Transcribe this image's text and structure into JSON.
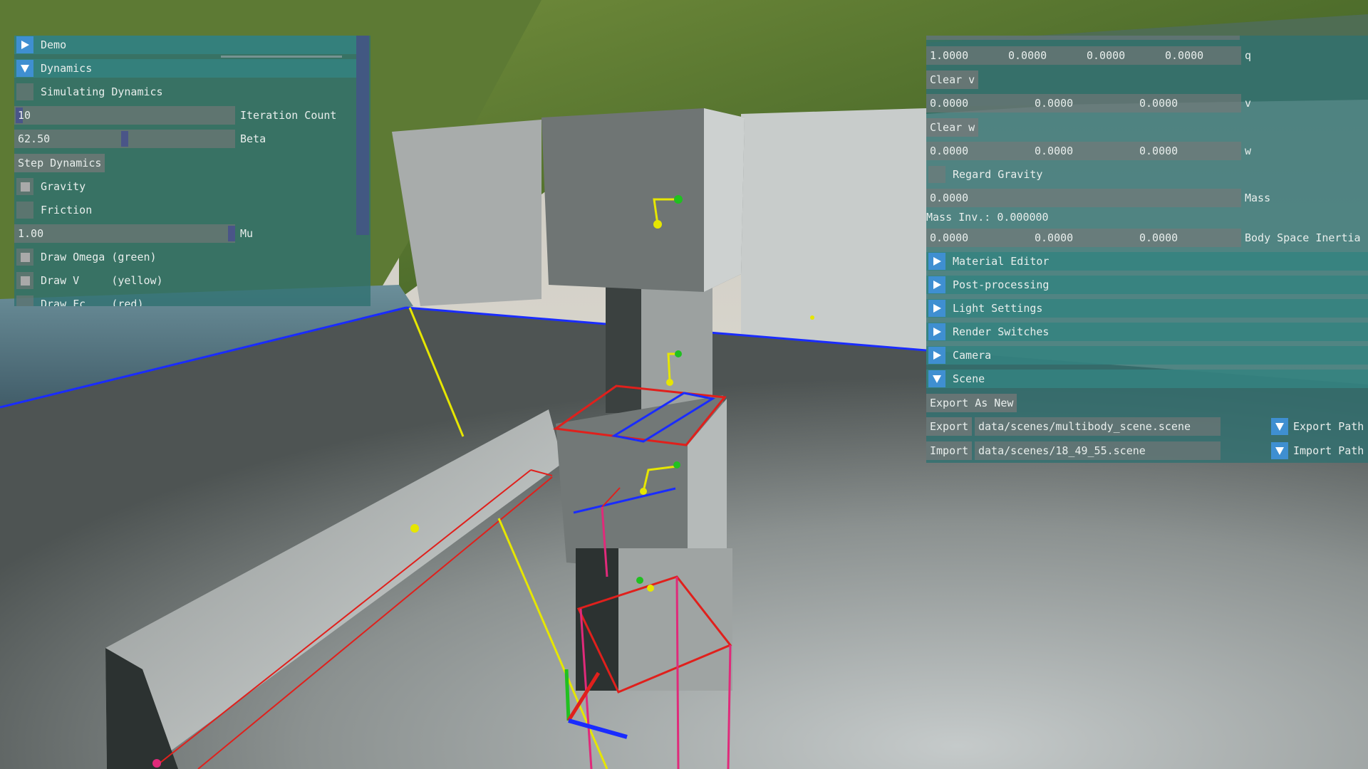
{
  "left_panel": {
    "demo_header": "Demo",
    "dynamics_header": "Dynamics",
    "simulating_dynamics": "Simulating Dynamics",
    "iteration_count": {
      "value": "10",
      "label": "Iteration Count"
    },
    "beta": {
      "value": "62.50",
      "label": "Beta"
    },
    "step_dynamics": "Step Dynamics",
    "gravity": "Gravity",
    "friction": "Friction",
    "mu": {
      "value": "1.00",
      "label": "Mu"
    },
    "draw_omega": "Draw Omega (green)",
    "draw_v": "Draw V     (yellow)",
    "draw_fc": "Draw Fc    (red)"
  },
  "right_panel": {
    "q": {
      "values": [
        "1.0000",
        "0.0000",
        "0.0000",
        "0.0000"
      ],
      "label": "q"
    },
    "clear_v": "Clear v",
    "v": {
      "values": [
        "0.0000",
        "0.0000",
        "0.0000"
      ],
      "label": "v"
    },
    "clear_w": "Clear w",
    "w": {
      "values": [
        "0.0000",
        "0.0000",
        "0.0000"
      ],
      "label": "w"
    },
    "regard_gravity": "Regard Gravity",
    "mass": {
      "value": "0.0000",
      "label": "Mass"
    },
    "mass_inv": "Mass Inv.: 0.000000",
    "inertia": {
      "values": [
        "0.0000",
        "0.0000",
        "0.0000"
      ],
      "label": "Body Space Inertia"
    },
    "sections": [
      "Material Editor",
      "Post-processing",
      "Light Settings",
      "Render Switches",
      "Camera"
    ],
    "scene_header": "Scene",
    "export_as_new": "Export As New",
    "export": {
      "button": "Export",
      "path": "data/scenes/multibody_scene.scene",
      "label": "Export Path"
    },
    "import": {
      "button": "Import",
      "path": "data/scenes/18_49_55.scene",
      "label": "Import Path"
    }
  }
}
